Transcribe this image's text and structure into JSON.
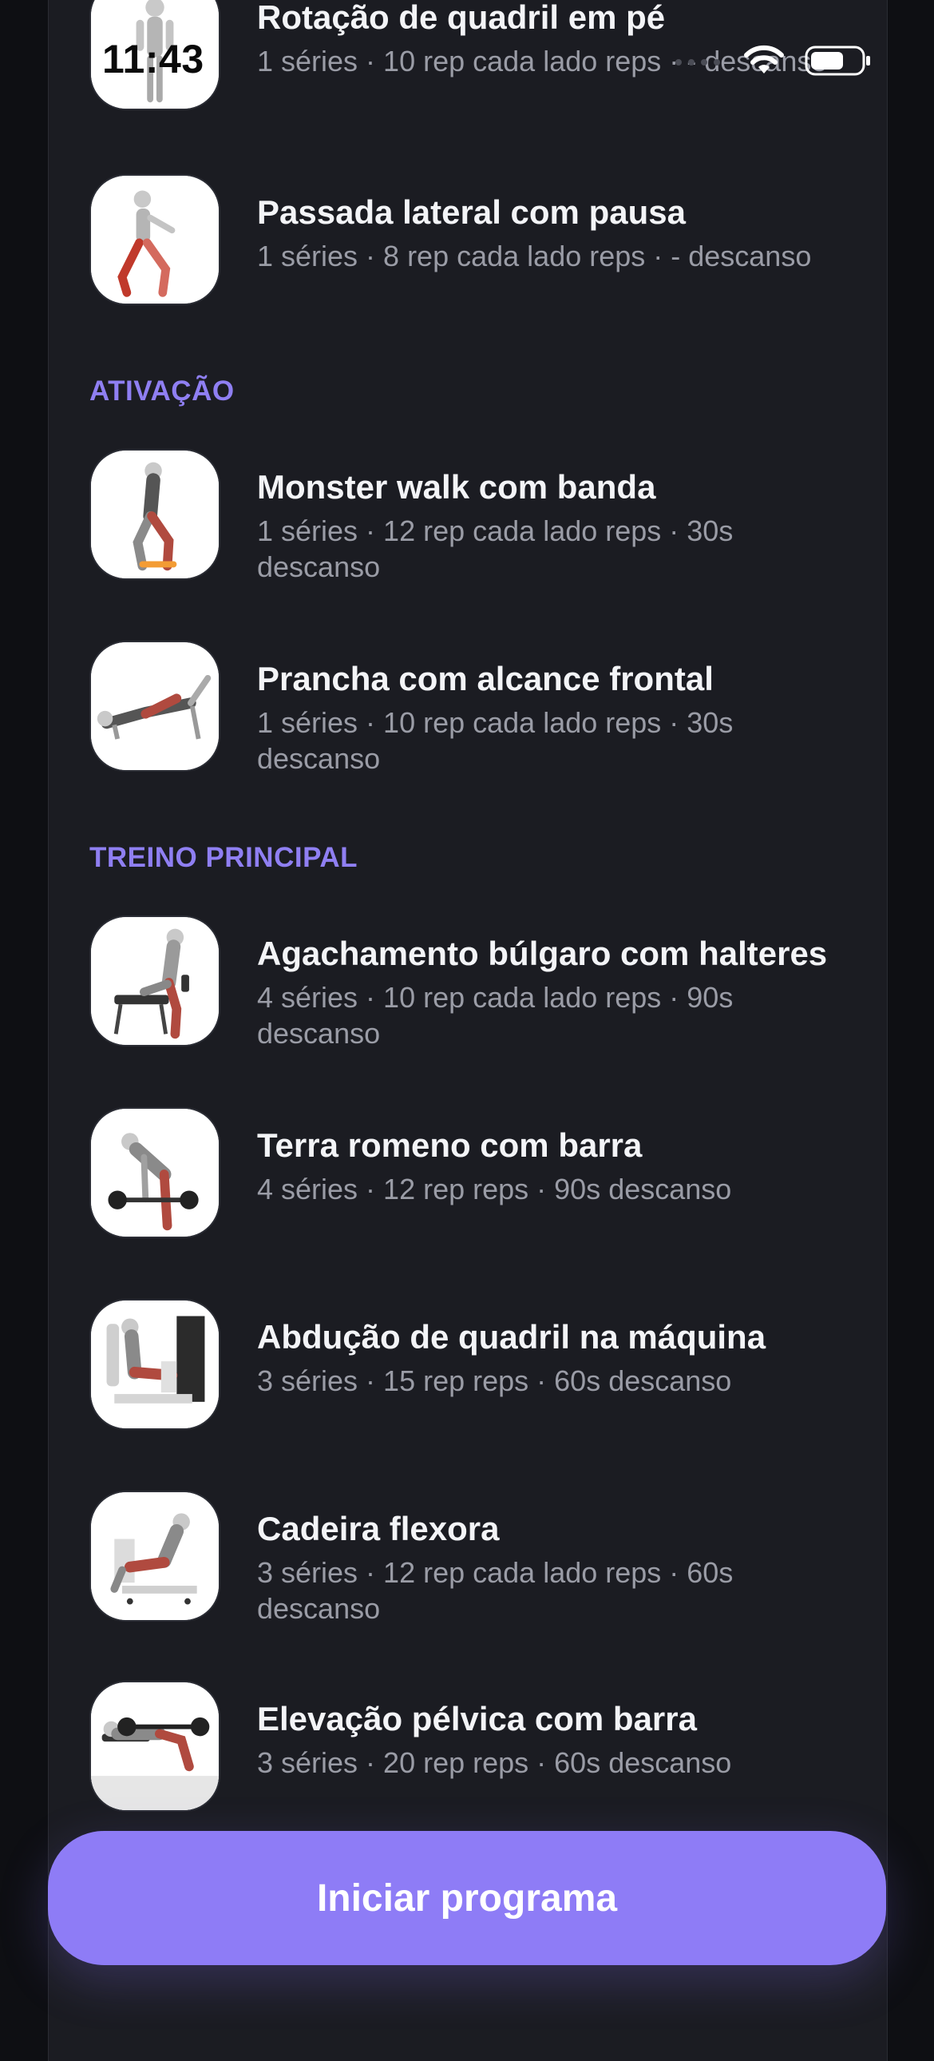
{
  "status_bar": {
    "time": "11:43"
  },
  "sections": {
    "activation": "ATIVAÇÃO",
    "main_training": "TREINO PRINCIPAL"
  },
  "exercises": [
    {
      "title": "Rotação de quadril em pé",
      "subtitle": "1 séries · 10 rep cada lado reps · - descanso"
    },
    {
      "title": "Passada lateral com pausa",
      "subtitle": "1 séries · 8 rep cada lado reps · - descanso"
    },
    {
      "title": "Monster walk com banda",
      "subtitle": "1 séries · 12 rep cada lado reps · 30s descanso"
    },
    {
      "title": "Prancha com alcance frontal",
      "subtitle": "1 séries · 10 rep cada lado reps · 30s descanso"
    },
    {
      "title": "Agachamento búlgaro com halteres",
      "subtitle": "4 séries · 10 rep cada lado reps · 90s descanso"
    },
    {
      "title": "Terra romeno com barra",
      "subtitle": "4 séries · 12 rep reps · 90s descanso"
    },
    {
      "title": "Abdução de quadril na máquina",
      "subtitle": "3 séries · 15 rep reps · 60s descanso"
    },
    {
      "title": "Cadeira flexora",
      "subtitle": "3 séries · 12 rep cada lado reps · 60s descanso"
    },
    {
      "title": "Elevação pélvica com barra",
      "subtitle": "3 séries · 20 rep reps · 60s descanso"
    }
  ],
  "cta": {
    "label": "Iniciar programa"
  },
  "colors": {
    "accent": "#8e7cf6",
    "section": "#8f7ff2",
    "background": "#1b1c22"
  }
}
